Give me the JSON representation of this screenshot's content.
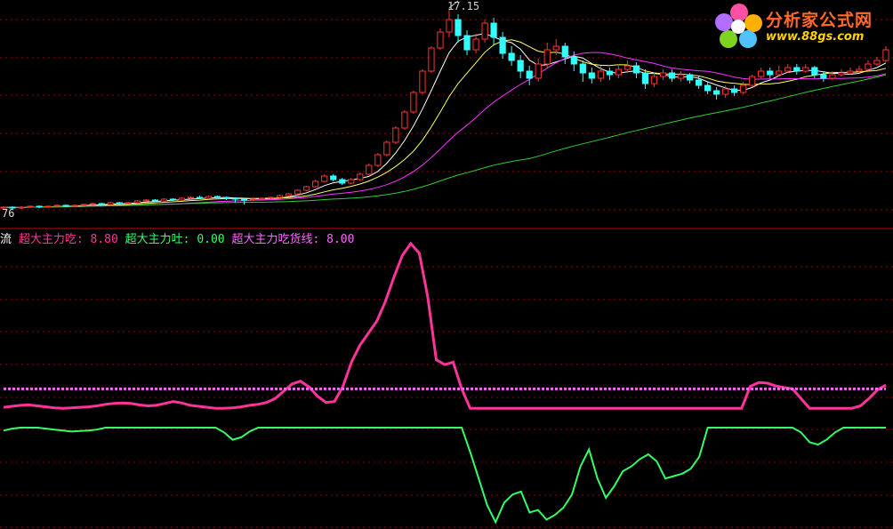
{
  "watermark": {
    "title": "分析家公式网",
    "url": "www.88gs.com"
  },
  "price_panel": {
    "high_label": "17.15",
    "low_label_fragment": "76"
  },
  "indicator_panel": {
    "name_fragment": "流",
    "series_labels": [
      {
        "name": "超大主力吃",
        "value": "8.80",
        "color": "#ff3399"
      },
      {
        "name": "超大主力吐",
        "value": "0.00",
        "color": "#33ff66"
      },
      {
        "name": "超大主力吃货线",
        "value": "8.00",
        "color": "#ff66ff"
      }
    ]
  },
  "colors": {
    "background": "#000000",
    "grid": "#990000",
    "up_candle": "#ff3333",
    "down_candle": "#33ffff",
    "ma5": "#ffffff",
    "ma10": "#ffff66",
    "ma20": "#ff33ff",
    "ma60": "#33cc33",
    "eat": "#ff3399",
    "spit": "#33ff66",
    "eat_line": "#ff66ff"
  },
  "chart_data": [
    {
      "type": "candlestick",
      "title": "",
      "yticks": [],
      "high": 17.15,
      "candles": [
        {
          "o": 5.9,
          "c": 5.95,
          "h": 6.0,
          "l": 5.85
        },
        {
          "o": 5.95,
          "c": 5.9,
          "h": 6.0,
          "l": 5.85
        },
        {
          "o": 5.9,
          "c": 5.95,
          "h": 6.0,
          "l": 5.85
        },
        {
          "o": 5.95,
          "c": 6.0,
          "h": 6.05,
          "l": 5.9
        },
        {
          "o": 6.0,
          "c": 5.95,
          "h": 6.05,
          "l": 5.9
        },
        {
          "o": 5.95,
          "c": 6.0,
          "h": 6.05,
          "l": 5.9
        },
        {
          "o": 6.0,
          "c": 6.05,
          "h": 6.1,
          "l": 5.95
        },
        {
          "o": 6.05,
          "c": 6.0,
          "h": 6.1,
          "l": 5.95
        },
        {
          "o": 6.0,
          "c": 6.05,
          "h": 6.1,
          "l": 5.95
        },
        {
          "o": 6.05,
          "c": 6.1,
          "h": 6.15,
          "l": 6.0
        },
        {
          "o": 6.1,
          "c": 6.15,
          "h": 6.2,
          "l": 6.05
        },
        {
          "o": 6.15,
          "c": 6.1,
          "h": 6.2,
          "l": 6.05
        },
        {
          "o": 6.1,
          "c": 6.2,
          "h": 6.25,
          "l": 6.05
        },
        {
          "o": 6.2,
          "c": 6.15,
          "h": 6.25,
          "l": 6.1
        },
        {
          "o": 6.15,
          "c": 6.2,
          "h": 6.25,
          "l": 6.1
        },
        {
          "o": 6.2,
          "c": 6.3,
          "h": 6.35,
          "l": 6.15
        },
        {
          "o": 6.3,
          "c": 6.35,
          "h": 6.4,
          "l": 6.25
        },
        {
          "o": 6.35,
          "c": 6.3,
          "h": 6.4,
          "l": 6.25
        },
        {
          "o": 6.3,
          "c": 6.4,
          "h": 6.45,
          "l": 6.25
        },
        {
          "o": 6.4,
          "c": 6.35,
          "h": 6.45,
          "l": 6.3
        },
        {
          "o": 6.35,
          "c": 6.45,
          "h": 6.5,
          "l": 6.3
        },
        {
          "o": 6.45,
          "c": 6.5,
          "h": 6.55,
          "l": 6.4
        },
        {
          "o": 6.5,
          "c": 6.45,
          "h": 6.6,
          "l": 6.4
        },
        {
          "o": 6.45,
          "c": 6.55,
          "h": 6.6,
          "l": 6.4
        },
        {
          "o": 6.55,
          "c": 6.5,
          "h": 6.6,
          "l": 6.45
        },
        {
          "o": 6.5,
          "c": 6.45,
          "h": 6.55,
          "l": 6.35
        },
        {
          "o": 6.45,
          "c": 6.4,
          "h": 6.5,
          "l": 6.2
        },
        {
          "o": 6.4,
          "c": 6.35,
          "h": 6.45,
          "l": 6.1
        },
        {
          "o": 6.35,
          "c": 6.4,
          "h": 6.5,
          "l": 6.3
        },
        {
          "o": 6.4,
          "c": 6.45,
          "h": 6.5,
          "l": 6.35
        },
        {
          "o": 6.45,
          "c": 6.5,
          "h": 6.55,
          "l": 6.4
        },
        {
          "o": 6.5,
          "c": 6.6,
          "h": 6.65,
          "l": 6.45
        },
        {
          "o": 6.6,
          "c": 6.7,
          "h": 6.75,
          "l": 6.55
        },
        {
          "o": 6.7,
          "c": 6.9,
          "h": 6.95,
          "l": 6.65
        },
        {
          "o": 6.9,
          "c": 7.1,
          "h": 7.15,
          "l": 6.85
        },
        {
          "o": 7.1,
          "c": 7.4,
          "h": 7.5,
          "l": 7.05
        },
        {
          "o": 7.4,
          "c": 7.7,
          "h": 7.8,
          "l": 7.35
        },
        {
          "o": 7.7,
          "c": 7.5,
          "h": 7.8,
          "l": 7.4
        },
        {
          "o": 7.5,
          "c": 7.3,
          "h": 7.6,
          "l": 7.2
        },
        {
          "o": 7.3,
          "c": 7.5,
          "h": 7.6,
          "l": 7.25
        },
        {
          "o": 7.5,
          "c": 7.8,
          "h": 7.9,
          "l": 7.45
        },
        {
          "o": 7.8,
          "c": 8.3,
          "h": 8.4,
          "l": 7.75
        },
        {
          "o": 8.3,
          "c": 8.9,
          "h": 9.0,
          "l": 8.2
        },
        {
          "o": 8.9,
          "c": 9.6,
          "h": 9.7,
          "l": 8.8
        },
        {
          "o": 9.6,
          "c": 10.4,
          "h": 10.5,
          "l": 9.5
        },
        {
          "o": 10.4,
          "c": 11.3,
          "h": 11.4,
          "l": 10.3
        },
        {
          "o": 11.3,
          "c": 12.4,
          "h": 12.5,
          "l": 11.2
        },
        {
          "o": 12.4,
          "c": 13.6,
          "h": 13.7,
          "l": 12.3
        },
        {
          "o": 13.6,
          "c": 14.9,
          "h": 15.0,
          "l": 13.5
        },
        {
          "o": 14.9,
          "c": 15.8,
          "h": 16.0,
          "l": 14.8
        },
        {
          "o": 15.8,
          "c": 16.5,
          "h": 17.15,
          "l": 15.5
        },
        {
          "o": 16.5,
          "c": 15.6,
          "h": 16.8,
          "l": 15.2
        },
        {
          "o": 15.6,
          "c": 14.8,
          "h": 15.9,
          "l": 14.5
        },
        {
          "o": 14.8,
          "c": 15.4,
          "h": 15.7,
          "l": 14.6
        },
        {
          "o": 15.4,
          "c": 16.3,
          "h": 16.5,
          "l": 15.2
        },
        {
          "o": 16.3,
          "c": 15.5,
          "h": 16.6,
          "l": 15.1
        },
        {
          "o": 15.5,
          "c": 14.6,
          "h": 15.8,
          "l": 14.3
        },
        {
          "o": 14.6,
          "c": 14.2,
          "h": 15.0,
          "l": 13.9
        },
        {
          "o": 14.2,
          "c": 13.6,
          "h": 14.5,
          "l": 13.2
        },
        {
          "o": 13.6,
          "c": 13.2,
          "h": 13.9,
          "l": 12.8
        },
        {
          "o": 13.2,
          "c": 14.0,
          "h": 14.3,
          "l": 13.0
        },
        {
          "o": 14.0,
          "c": 14.8,
          "h": 15.2,
          "l": 13.8
        },
        {
          "o": 14.8,
          "c": 15.0,
          "h": 15.4,
          "l": 14.5
        },
        {
          "o": 15.0,
          "c": 14.4,
          "h": 15.2,
          "l": 14.0
        },
        {
          "o": 14.4,
          "c": 14.0,
          "h": 14.7,
          "l": 13.6
        },
        {
          "o": 14.0,
          "c": 13.5,
          "h": 14.2,
          "l": 13.0
        },
        {
          "o": 13.5,
          "c": 13.2,
          "h": 13.8,
          "l": 12.9
        },
        {
          "o": 13.2,
          "c": 13.6,
          "h": 13.9,
          "l": 13.0
        },
        {
          "o": 13.6,
          "c": 13.4,
          "h": 13.8,
          "l": 13.1
        },
        {
          "o": 13.4,
          "c": 13.7,
          "h": 14.0,
          "l": 13.2
        },
        {
          "o": 13.7,
          "c": 13.9,
          "h": 14.2,
          "l": 13.5
        },
        {
          "o": 13.9,
          "c": 13.5,
          "h": 14.1,
          "l": 13.2
        },
        {
          "o": 13.5,
          "c": 12.9,
          "h": 13.7,
          "l": 12.6
        },
        {
          "o": 12.9,
          "c": 13.3,
          "h": 13.5,
          "l": 12.7
        },
        {
          "o": 13.3,
          "c": 13.5,
          "h": 13.7,
          "l": 13.1
        },
        {
          "o": 13.5,
          "c": 13.2,
          "h": 13.7,
          "l": 13.0
        },
        {
          "o": 13.2,
          "c": 13.4,
          "h": 13.6,
          "l": 13.0
        },
        {
          "o": 13.4,
          "c": 13.1,
          "h": 13.5,
          "l": 12.9
        },
        {
          "o": 13.1,
          "c": 12.8,
          "h": 13.3,
          "l": 12.6
        },
        {
          "o": 12.8,
          "c": 12.5,
          "h": 13.0,
          "l": 12.3
        },
        {
          "o": 12.5,
          "c": 12.3,
          "h": 12.7,
          "l": 12.0
        },
        {
          "o": 12.3,
          "c": 12.6,
          "h": 12.8,
          "l": 12.1
        },
        {
          "o": 12.6,
          "c": 12.4,
          "h": 12.8,
          "l": 12.2
        },
        {
          "o": 12.4,
          "c": 12.8,
          "h": 13.0,
          "l": 12.3
        },
        {
          "o": 12.8,
          "c": 13.3,
          "h": 13.4,
          "l": 12.7
        },
        {
          "o": 13.3,
          "c": 13.6,
          "h": 13.8,
          "l": 13.2
        },
        {
          "o": 13.6,
          "c": 13.4,
          "h": 13.8,
          "l": 13.2
        },
        {
          "o": 13.4,
          "c": 13.6,
          "h": 13.9,
          "l": 13.3
        },
        {
          "o": 13.6,
          "c": 13.8,
          "h": 14.0,
          "l": 13.5
        },
        {
          "o": 13.8,
          "c": 13.6,
          "h": 14.0,
          "l": 13.4
        },
        {
          "o": 13.6,
          "c": 13.8,
          "h": 14.0,
          "l": 13.5
        },
        {
          "o": 13.8,
          "c": 13.4,
          "h": 13.9,
          "l": 13.2
        },
        {
          "o": 13.4,
          "c": 13.2,
          "h": 13.6,
          "l": 13.0
        },
        {
          "o": 13.2,
          "c": 13.4,
          "h": 13.6,
          "l": 13.1
        },
        {
          "o": 13.4,
          "c": 13.5,
          "h": 13.7,
          "l": 13.3
        },
        {
          "o": 13.5,
          "c": 13.6,
          "h": 13.8,
          "l": 13.4
        },
        {
          "o": 13.6,
          "c": 13.7,
          "h": 13.9,
          "l": 13.5
        },
        {
          "o": 13.7,
          "c": 14.0,
          "h": 14.2,
          "l": 13.6
        },
        {
          "o": 14.0,
          "c": 14.2,
          "h": 14.4,
          "l": 13.9
        },
        {
          "o": 14.2,
          "c": 14.8,
          "h": 15.0,
          "l": 14.1
        }
      ],
      "moving_averages": [
        {
          "name": "MA5",
          "period": 5
        },
        {
          "name": "MA10",
          "period": 10
        },
        {
          "name": "MA20",
          "period": 20
        },
        {
          "name": "MA60",
          "period": 60
        }
      ]
    },
    {
      "type": "line",
      "title": "",
      "series": [
        {
          "name": "超大主力吃",
          "current": "8.80",
          "values": [
            4.2,
            4.4,
            4.6,
            4.7,
            4.5,
            4.3,
            4.1,
            4.0,
            4.1,
            4.2,
            4.3,
            4.5,
            4.8,
            5.0,
            5.1,
            5.0,
            4.7,
            4.5,
            4.6,
            5.0,
            5.4,
            5.1,
            4.6,
            4.4,
            4.2,
            4.0,
            4.0,
            4.1,
            4.3,
            4.6,
            4.8,
            5.2,
            6.0,
            7.5,
            9.0,
            9.6,
            8.4,
            6.5,
            5.2,
            5.4,
            8.5,
            13.5,
            17.0,
            19.5,
            22.0,
            26.0,
            31.0,
            35.5,
            38.0,
            36.0,
            27.0,
            14.0,
            13.0,
            13.5,
            8.0,
            4.0,
            4.0,
            4.0,
            4.0,
            4.0,
            4.0,
            4.0,
            4.0,
            4.0,
            4.0,
            4.0,
            4.0,
            4.0,
            4.0,
            4.0,
            4.0,
            4.0,
            4.0,
            4.0,
            4.0,
            4.0,
            4.0,
            4.0,
            4.0,
            4.0,
            4.0,
            4.0,
            4.0,
            4.0,
            4.0,
            4.0,
            4.0,
            4.0,
            8.5,
            9.3,
            9.2,
            8.6,
            8.3,
            8.0,
            6.0,
            4.0,
            4.0,
            4.0,
            4.0,
            4.0,
            4.0,
            4.5,
            6.0,
            7.8,
            8.8
          ]
        },
        {
          "name": "超大主力吐",
          "current": "0.00",
          "values": [
            -0.6,
            -0.2,
            0.0,
            0.0,
            0.0,
            -0.2,
            -0.4,
            -0.6,
            -0.8,
            -0.7,
            -0.6,
            -0.4,
            0.0,
            0.0,
            0.0,
            0.0,
            0.0,
            0.0,
            0.0,
            0.0,
            0.0,
            0.0,
            0.0,
            0.0,
            0.0,
            0.0,
            -1.0,
            -2.5,
            -2.0,
            -0.8,
            0.0,
            0.0,
            0.0,
            0.0,
            0.0,
            0.0,
            0.0,
            0.0,
            0.0,
            0.0,
            0.0,
            0.0,
            0.0,
            0.0,
            0.0,
            0.0,
            0.0,
            0.0,
            0.0,
            0.0,
            0.0,
            0.0,
            0.0,
            0.0,
            0.0,
            -5.0,
            -10.5,
            -16.0,
            -19.5,
            -15.5,
            -13.8,
            -13.2,
            -17.5,
            -17.0,
            -19.0,
            -18.0,
            -16.5,
            -13.8,
            -8.0,
            -4.5,
            -10.5,
            -14.5,
            -12.0,
            -9.0,
            -8.0,
            -6.5,
            -5.5,
            -7.0,
            -10.5,
            -10.0,
            -9.5,
            -8.5,
            -6.0,
            0.0,
            0.0,
            0.0,
            0.0,
            0.0,
            0.0,
            0.0,
            0.0,
            0.0,
            0.0,
            0.0,
            -1.0,
            -3.0,
            -3.5,
            -2.5,
            -1.0,
            0.0,
            0.0,
            0.0,
            0.0,
            0.0,
            0.0
          ]
        },
        {
          "name": "超大主力吃货线",
          "current": "8.00",
          "values": [
            8,
            8,
            8,
            8,
            8,
            8,
            8,
            8,
            8,
            8,
            8,
            8,
            8,
            8,
            8,
            8,
            8,
            8,
            8,
            8,
            8,
            8,
            8,
            8,
            8,
            8,
            8,
            8,
            8,
            8,
            8,
            8,
            8,
            8,
            8,
            8,
            8,
            8,
            8,
            8,
            8,
            8,
            8,
            8,
            8,
            8,
            8,
            8,
            8,
            8,
            8,
            8,
            8,
            8,
            8,
            8,
            8,
            8,
            8,
            8,
            8,
            8,
            8,
            8,
            8,
            8,
            8,
            8,
            8,
            8,
            8,
            8,
            8,
            8,
            8,
            8,
            8,
            8,
            8,
            8,
            8,
            8,
            8,
            8,
            8,
            8,
            8,
            8,
            8,
            8,
            8,
            8,
            8,
            8,
            8,
            8,
            8,
            8,
            8,
            8,
            8,
            8,
            8,
            8,
            8
          ]
        }
      ]
    }
  ]
}
